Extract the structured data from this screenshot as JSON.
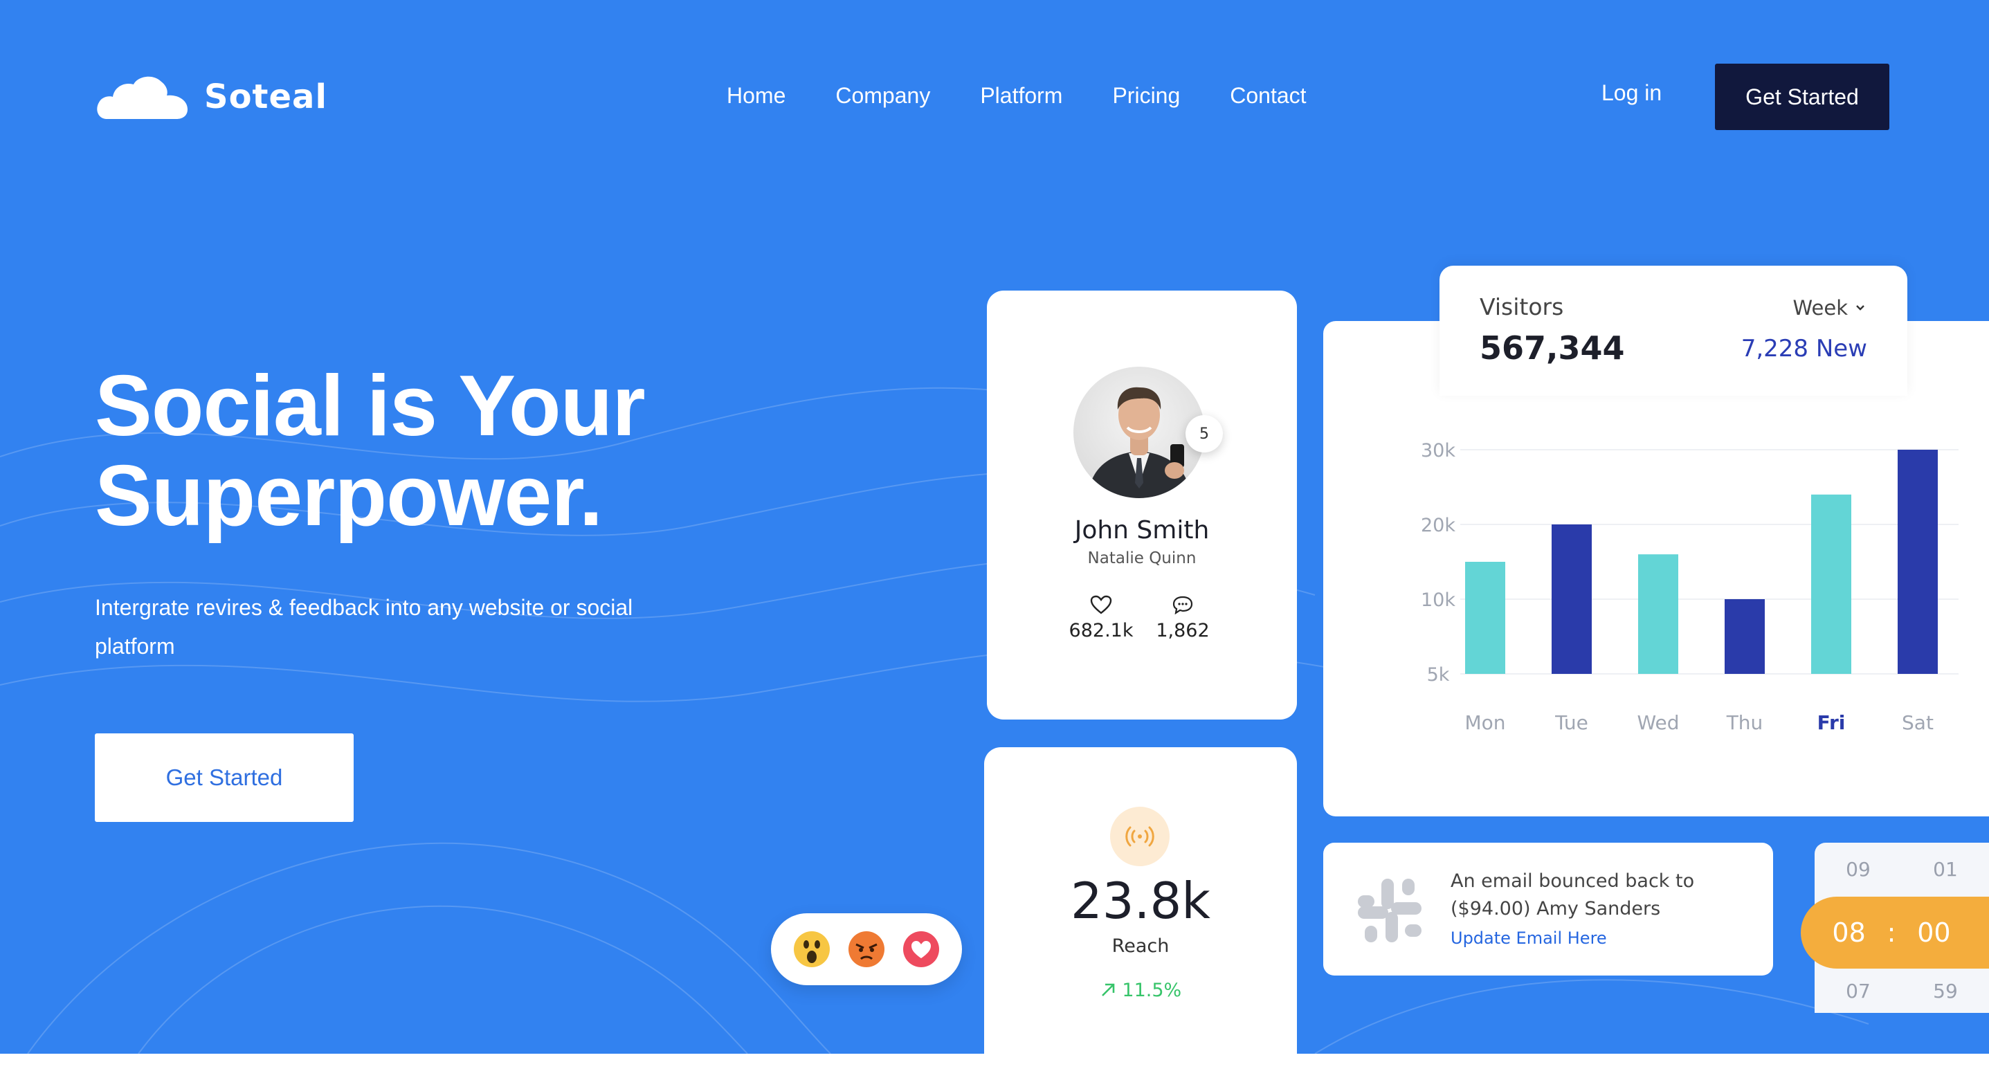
{
  "brand": {
    "name": "Soteal"
  },
  "nav": {
    "items": [
      "Home",
      "Company",
      "Platform",
      "Pricing",
      "Contact"
    ],
    "login": "Log in",
    "cta": "Get Started"
  },
  "hero": {
    "headline_line1": "Social is Your",
    "headline_line2": "Superpower.",
    "subtext": "Intergrate revires & feedback into any website or social platform",
    "cta": "Get Started"
  },
  "profile": {
    "name": "John Smith",
    "subtitle": "Natalie Quinn",
    "badge_count": "5",
    "likes": "682.1k",
    "comments": "1,862",
    "icons": [
      "heart-icon",
      "comment-icon"
    ]
  },
  "reach": {
    "value": "23.8k",
    "label": "Reach",
    "growth": "11.5%",
    "icon": "broadcast-icon"
  },
  "reactions": [
    "wow-emoji",
    "angry-emoji",
    "heart-emoji"
  ],
  "visitors": {
    "label": "Visitors",
    "value": "567,344",
    "period": "Week",
    "new": "7,228 New"
  },
  "chart_data": {
    "type": "bar",
    "categories": [
      "Mon",
      "Tue",
      "Wed",
      "Thu",
      "Fri",
      "Sat"
    ],
    "values": [
      15000,
      20000,
      16000,
      10000,
      24000,
      30000
    ],
    "y_ticks": [
      "30k",
      "20k",
      "10k",
      "5k"
    ],
    "highlight_category": "Fri",
    "colors": [
      "#63d5d6",
      "#2a3baa",
      "#63d5d6",
      "#2a3baa",
      "#63d5d6",
      "#2a3baa"
    ],
    "grid": true
  },
  "notification": {
    "message": "An email bounced back to ($94.00) Amy Sanders",
    "link": "Update Email Here",
    "icon": "slack-icon"
  },
  "time_picker": {
    "prev_hour": "09",
    "prev_minute": "01",
    "hour": "08",
    "separator": ":",
    "minute": "00",
    "next_hour": "07",
    "next_minute": "59"
  },
  "colors": {
    "hero_bg": "#3282f0",
    "dark_button": "#11183d",
    "accent_teal": "#63d5d6",
    "accent_navy": "#2a3baa",
    "accent_orange": "#f4ad3d"
  }
}
